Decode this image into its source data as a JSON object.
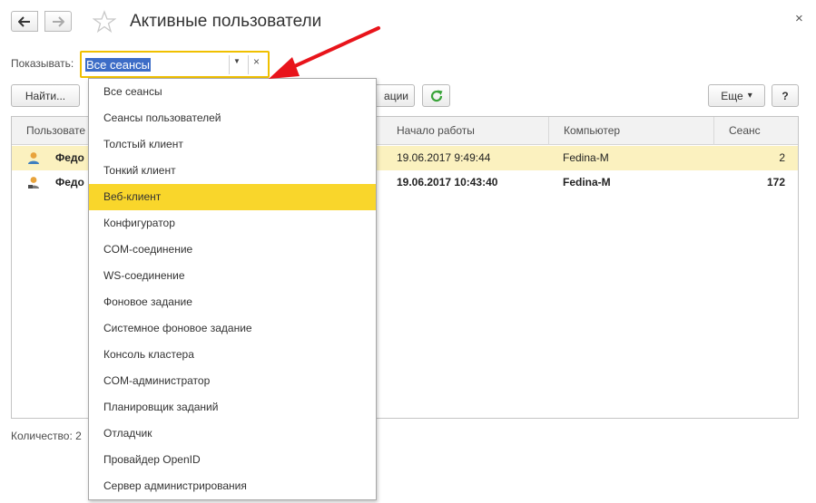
{
  "window": {
    "title": "Активные пользователи",
    "close_glyph": "×"
  },
  "filter": {
    "label": "Показывать:",
    "value": "Все сеансы",
    "clear_glyph": "×",
    "arrow_glyph": "▼"
  },
  "toolbar": {
    "find_label": "Найти...",
    "actions_label": "ации",
    "more_label": "Еще",
    "more_arrow": "▾",
    "help_label": "?"
  },
  "table": {
    "columns": [
      "Пользовате",
      "Начало работы",
      "Компьютер",
      "Сеанс"
    ],
    "rows": [
      {
        "user": "Федо",
        "start": "19.06.2017 9:49:44",
        "computer": "Fedina-M",
        "session": "2",
        "selected": true,
        "bold": false
      },
      {
        "user": "Федо",
        "start": "19.06.2017 10:43:40",
        "computer": "Fedina-M",
        "session": "172",
        "selected": false,
        "bold": true
      }
    ]
  },
  "footer": {
    "count_label": "Количество: 2"
  },
  "dropdown": {
    "items": [
      "Все сеансы",
      "Сеансы пользователей",
      "Толстый клиент",
      "Тонкий клиент",
      "Веб-клиент",
      "Конфигуратор",
      "COM-соединение",
      "WS-соединение",
      "Фоновое задание",
      "Системное фоновое задание",
      "Консоль кластера",
      "COM-администратор",
      "Планировщик заданий",
      "Отладчик",
      "Провайдер OpenID",
      "Сервер администрирования"
    ],
    "highlighted_index": 4
  },
  "colors": {
    "accent_yellow": "#f9d62b",
    "selected_row": "#fbf1bf",
    "selection_blue": "#3d6dc7",
    "refresh_green": "#3aa43a",
    "annotation_red": "#e8141b"
  },
  "icons": [
    "back-arrow-icon",
    "forward-arrow-icon",
    "star-icon",
    "close-icon",
    "refresh-icon",
    "user-icon",
    "dropdown-arrow-icon",
    "clear-icon"
  ]
}
